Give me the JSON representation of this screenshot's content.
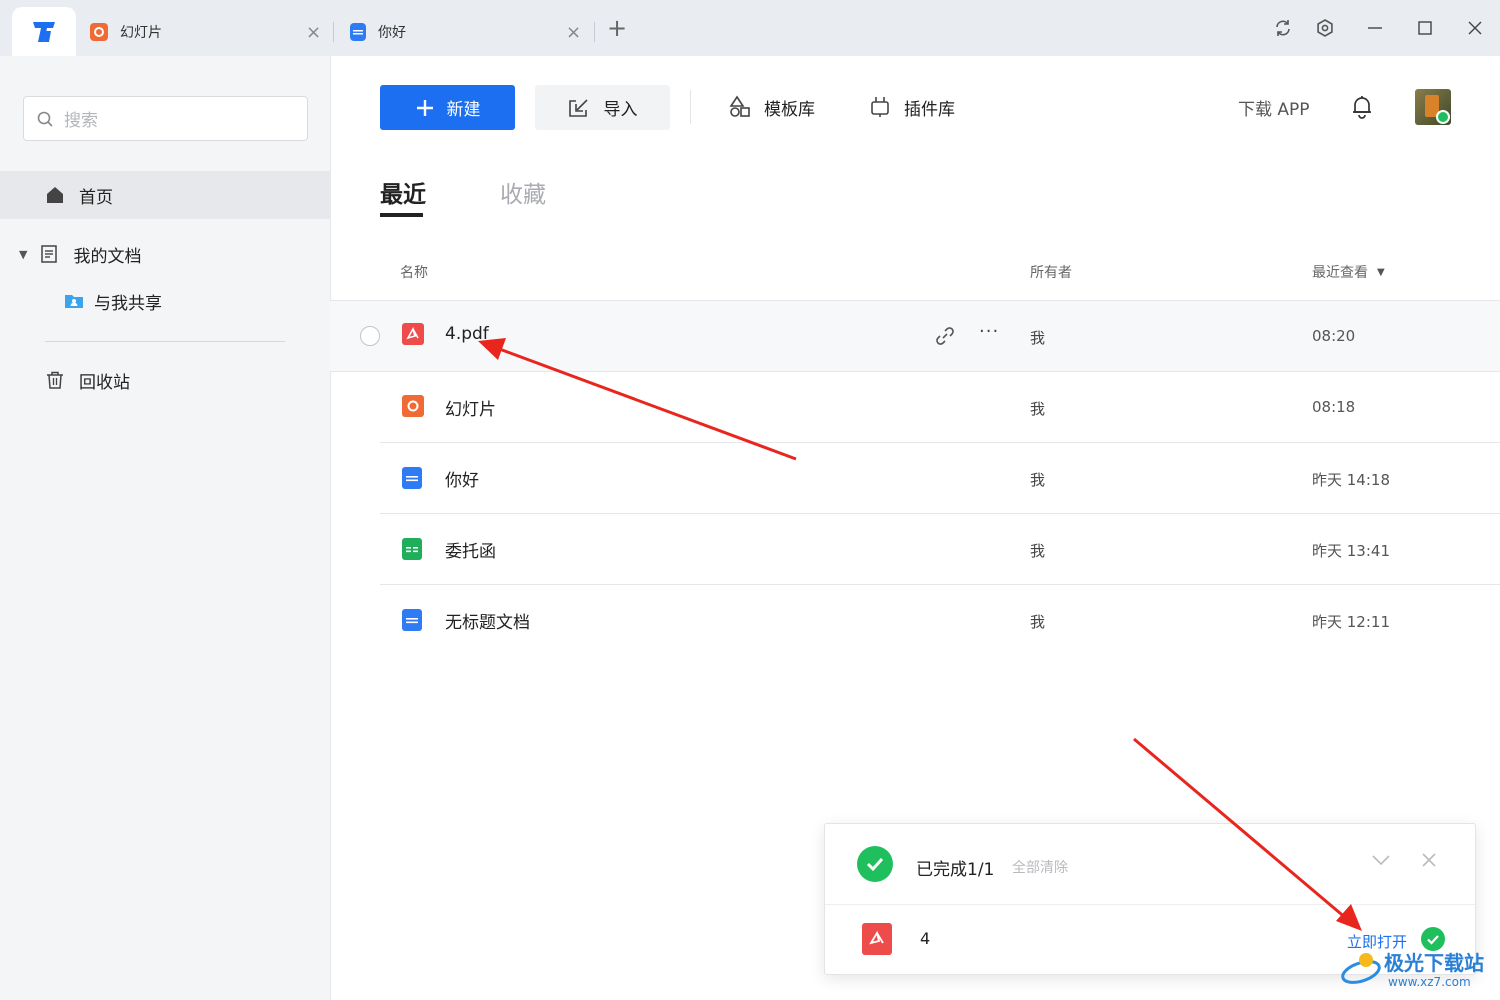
{
  "titlebar": {
    "tabs": [
      {
        "label": "幻灯片",
        "icon": "slides-icon",
        "color": "#f06a35"
      },
      {
        "label": "你好",
        "icon": "doc-icon",
        "color": "#2f7bf5"
      }
    ],
    "add_tab_icon": "plus-icon",
    "controls": [
      "refresh-icon",
      "settings-icon",
      "minimize-icon",
      "maximize-icon",
      "close-icon"
    ]
  },
  "sidebar": {
    "search_placeholder": "搜索",
    "items": [
      {
        "label": "首页",
        "icon": "home-icon",
        "active": true
      },
      {
        "label": "我的文档",
        "icon": "document-icon",
        "expanded": true
      },
      {
        "label": "与我共享",
        "icon": "shared-folder-icon"
      },
      {
        "label": "回收站",
        "icon": "trash-icon"
      }
    ]
  },
  "toolbar": {
    "new_label": "新建",
    "import_label": "导入",
    "templates_label": "模板库",
    "plugins_label": "插件库",
    "download_app_label": "下载 APP",
    "accent": "#1c6ff0"
  },
  "tabs": {
    "recent": "最近",
    "favorites": "收藏"
  },
  "table": {
    "columns": {
      "name": "名称",
      "owner": "所有者",
      "last_viewed": "最近查看"
    },
    "rows": [
      {
        "name": "4.pdf",
        "type": "pdf",
        "owner": "我",
        "time": "08:20"
      },
      {
        "name": "幻灯片",
        "type": "slides",
        "owner": "我",
        "time": "08:18"
      },
      {
        "name": "你好",
        "type": "doc",
        "owner": "我",
        "time": "昨天 14:18"
      },
      {
        "name": "委托函",
        "type": "sheet",
        "owner": "我",
        "time": "昨天 13:41"
      },
      {
        "name": "无标题文档",
        "type": "doc",
        "owner": "我",
        "time": "昨天 12:11"
      }
    ]
  },
  "popup": {
    "status": "已完成1/1",
    "clear_all": "全部清除",
    "file_name": "4",
    "open_now": "立即打开",
    "success_color": "#1fbf5d"
  },
  "watermark": {
    "text": "极光下载站",
    "url": "www.xz7.com"
  }
}
